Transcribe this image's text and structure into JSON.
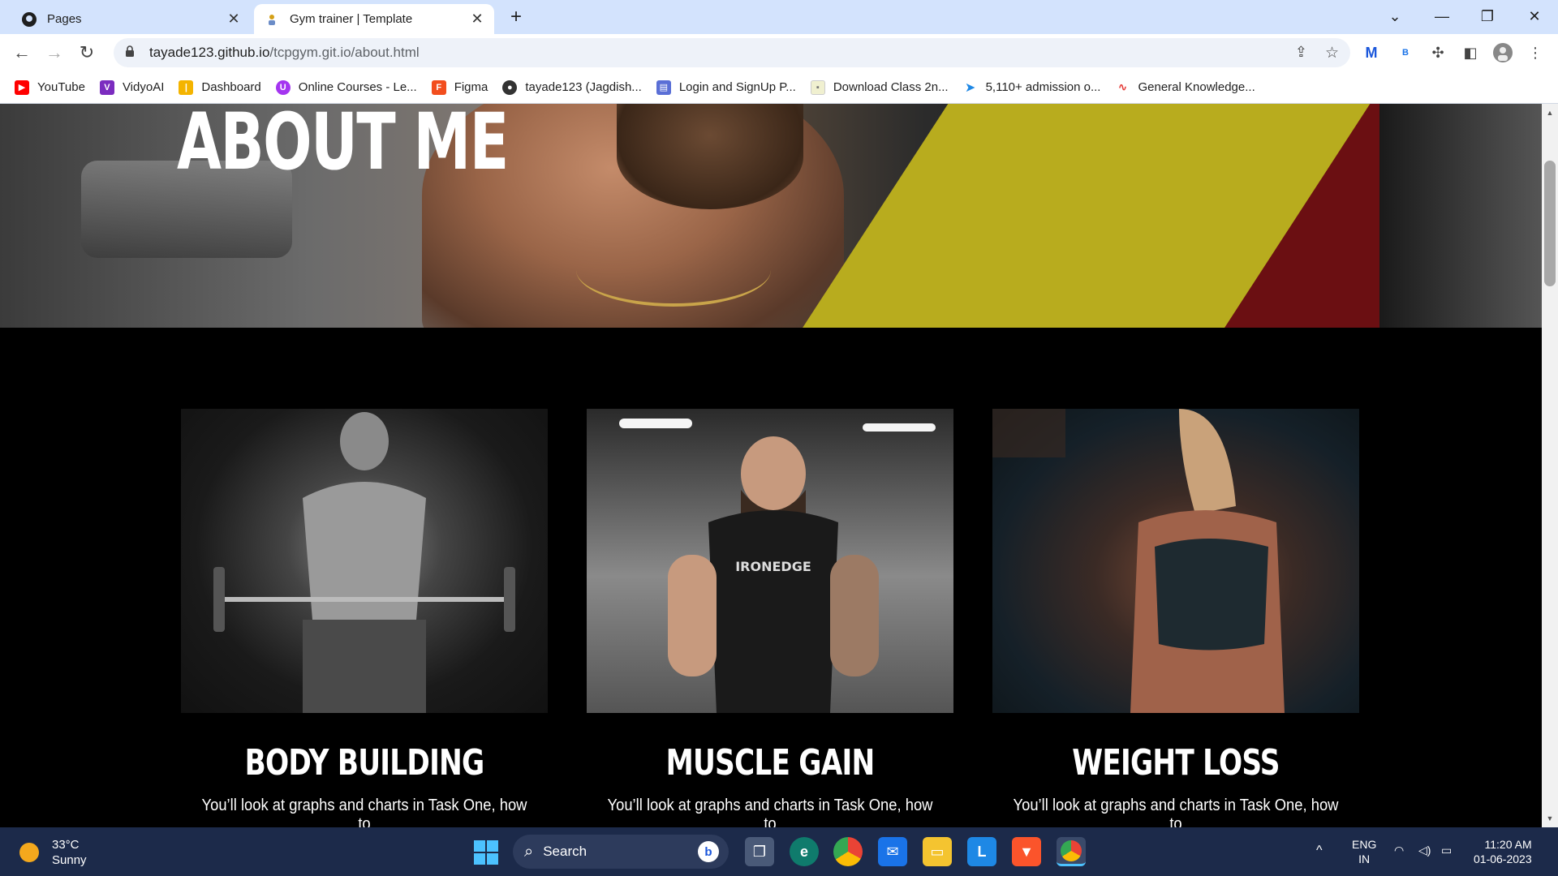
{
  "browser": {
    "tabs": [
      {
        "label": "Pages",
        "icon": "github-icon",
        "active": false
      },
      {
        "label": "Gym trainer | Template",
        "icon": "site-favicon-icon",
        "active": true
      }
    ],
    "new_tab": "+",
    "url_host": "tayade123.github.io",
    "url_path": "/tcpgym.git.io/about.html",
    "window_controls": [
      "chevron-down-icon",
      "minimize-icon",
      "restore-icon",
      "close-icon"
    ]
  },
  "bookmarks": [
    {
      "label": "YouTube",
      "icon": "youtube-icon",
      "color": "#ff0000"
    },
    {
      "label": "VidyoAI",
      "icon": "vidyoai-icon",
      "color": "#7b2cbf"
    },
    {
      "label": "Dashboard",
      "icon": "dashboard-icon",
      "color": "#f4b400"
    },
    {
      "label": "Online Courses - Le...",
      "icon": "udemy-icon",
      "color": "#a435f0"
    },
    {
      "label": "Figma",
      "icon": "figma-icon",
      "color": "#f24e1e"
    },
    {
      "label": "tayade123 (Jagdish...",
      "icon": "github-icon",
      "color": "#333333"
    },
    {
      "label": "Login and SignUp P...",
      "icon": "page-icon",
      "color": "#5a6fd6"
    },
    {
      "label": "Download Class 2n...",
      "icon": "page-icon",
      "color": "#c8b600"
    },
    {
      "label": "5,110+ admission o...",
      "icon": "arrow-icon",
      "color": "#1e88e5"
    },
    {
      "label": "General Knowledge...",
      "icon": "page-icon",
      "color": "#e53935"
    }
  ],
  "hero": {
    "title": "ABOUT ME"
  },
  "cards": [
    {
      "title": "BODY BUILDING",
      "text": "You’ll look at graphs and charts in Task One, how to"
    },
    {
      "title": "MUSCLE GAIN",
      "text": "You’ll look at graphs and charts in Task One, how to"
    },
    {
      "title": "WEIGHT LOSS",
      "text": "You’ll look at graphs and charts in Task One, how to"
    }
  ],
  "taskbar": {
    "temp": "33°C",
    "condition": "Sunny",
    "search_label": "Search",
    "lang1": "ENG",
    "lang2": "IN",
    "time": "11:20 AM",
    "date": "01-06-2023"
  },
  "colors": {
    "accent_yellow": "#b8ac1e",
    "accent_red": "#6b0f12",
    "chrome_bg": "#d3e3fd",
    "taskbar_bg": "#1c2a4a"
  }
}
